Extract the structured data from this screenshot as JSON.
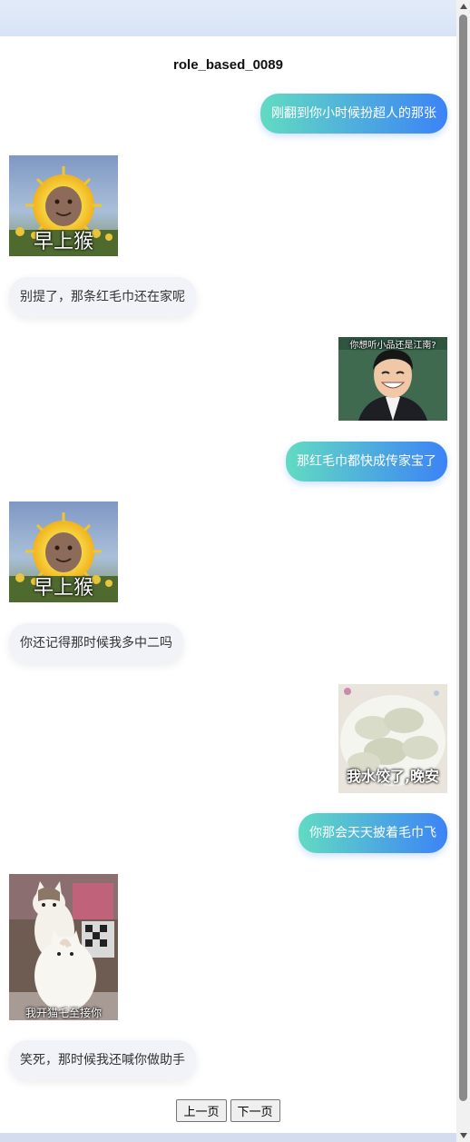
{
  "title": "role_based_0089",
  "messages": [
    {
      "side": "right",
      "type": "text",
      "text": "刚翻到你小时候扮超人的那张"
    },
    {
      "side": "left",
      "type": "sticker",
      "icon": "sun-baby-sticker",
      "caption": "早上猴"
    },
    {
      "side": "left",
      "type": "text",
      "text": "别提了，那条红毛巾还在家呢"
    },
    {
      "side": "right",
      "type": "sticker",
      "icon": "smiling-man-sticker",
      "caption": "你想听小品还是江南?"
    },
    {
      "side": "right",
      "type": "text",
      "text": "那红毛巾都快成传家宝了"
    },
    {
      "side": "left",
      "type": "sticker",
      "icon": "sun-baby-sticker",
      "caption": "早上猴"
    },
    {
      "side": "left",
      "type": "text",
      "text": "你还记得那时候我多中二吗"
    },
    {
      "side": "right",
      "type": "sticker",
      "icon": "dumplings-sticker",
      "caption": "我水饺了,晚安"
    },
    {
      "side": "right",
      "type": "text",
      "text": "你那会天天披着毛巾飞"
    },
    {
      "side": "left",
      "type": "sticker",
      "icon": "cat-driving-sticker",
      "caption": "我开猫乇至接你"
    },
    {
      "side": "left",
      "type": "text",
      "text": "笑死，那时候我还喊你做助手"
    }
  ],
  "pager": {
    "prev": "上一页",
    "next": "下一页"
  },
  "colors": {
    "bubble_right_start": "#62dbc2",
    "bubble_right_end": "#3c83f6",
    "bubble_left": "#f1f3f8"
  }
}
